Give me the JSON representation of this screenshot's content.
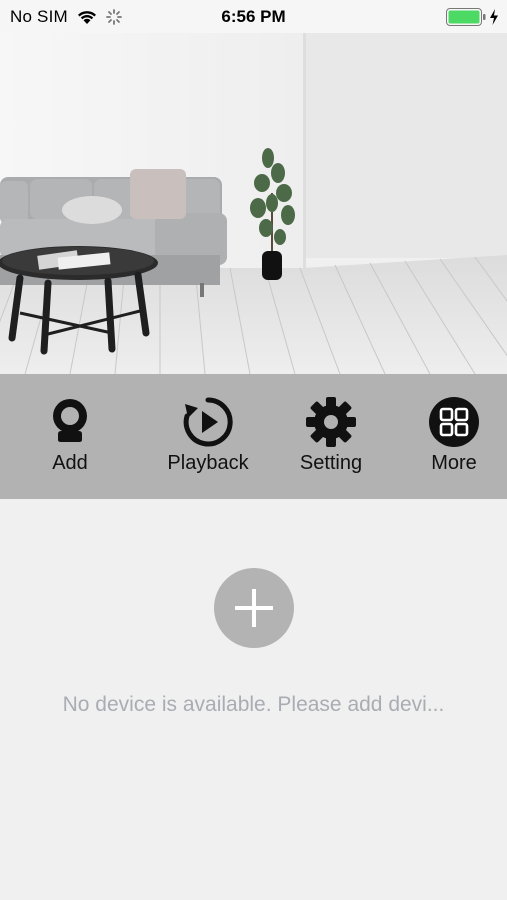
{
  "status_bar": {
    "carrier": "No SIM",
    "time": "6:56 PM",
    "icons": [
      "wifi-icon",
      "activity-spinner-icon",
      "battery-icon",
      "charging-bolt-icon"
    ],
    "battery_color": "#4cd964"
  },
  "banner": {
    "image": "living-room-photo"
  },
  "toolbar": {
    "background": "#b2b2b2",
    "items": [
      {
        "label": "Add",
        "icon": "camera-icon"
      },
      {
        "label": "Playback",
        "icon": "playback-icon"
      },
      {
        "label": "Setting",
        "icon": "gear-icon"
      },
      {
        "label": "More",
        "icon": "grid-icon"
      }
    ]
  },
  "empty_state": {
    "add_icon": "plus-icon",
    "message": "No device is available. Please add devi..."
  }
}
